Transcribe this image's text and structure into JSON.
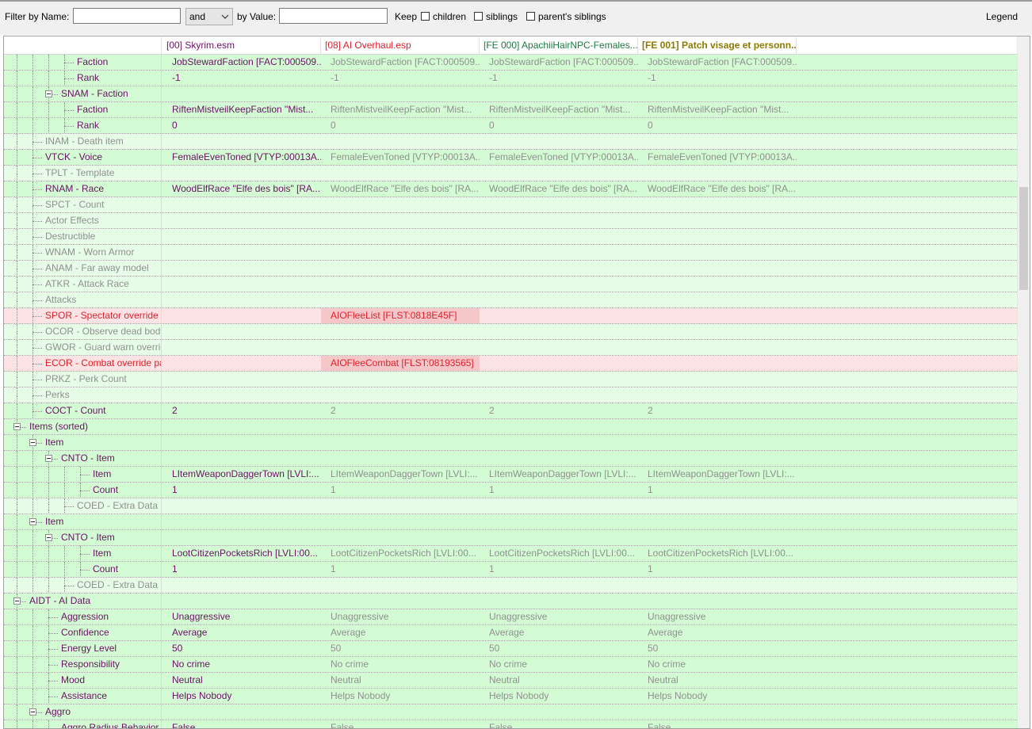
{
  "toolbar": {
    "filter_by_name_label": "Filter by Name:",
    "name_value": "",
    "operator": "and",
    "by_value_label": "by Value:",
    "value_value": "",
    "keep_label": "Keep",
    "children_label": "children",
    "siblings_label": "siblings",
    "parents_siblings_label": "parent's siblings",
    "legend_label": "Legend"
  },
  "columns": [
    {
      "label": "",
      "color": "#000000"
    },
    {
      "label": "[00] Skyrim.esm",
      "color": "#6b0f66"
    },
    {
      "label": "[08] AI Overhaul.esp",
      "color": "#e0202d"
    },
    {
      "label": "[FE 000] ApachiiHairNPC-Females...",
      "color": "#1d7a40"
    },
    {
      "label": "[FE 001] Patch visage et personn...",
      "color": "#8b7a00"
    }
  ],
  "colors": {
    "row_green": "#d4fcd4",
    "row_light_green": "#e8fde8",
    "row_pink": "#fde3e3",
    "cell_red_highlight": "#f6c7c9",
    "label_purple": "#6b0f66",
    "value_gray": "#8f8f8f",
    "conflict_red": "#e0202d"
  },
  "rows": [
    {
      "label": "Faction",
      "depth": 3,
      "expander": false,
      "style": "purple",
      "bg": "green",
      "v": [
        "JobStewardFaction [FACT:000509...",
        "JobStewardFaction [FACT:000509...",
        "JobStewardFaction [FACT:000509...",
        "JobStewardFaction [FACT:000509..."
      ]
    },
    {
      "label": "Rank",
      "depth": 3,
      "expander": false,
      "style": "purple",
      "bg": "green",
      "v": [
        "-1",
        "-1",
        "-1",
        "-1"
      ]
    },
    {
      "label": "SNAM - Faction",
      "depth": 2,
      "expander": true,
      "style": "purple",
      "bg": "green",
      "v": [
        "",
        "",
        "",
        ""
      ]
    },
    {
      "label": "Faction",
      "depth": 3,
      "expander": false,
      "style": "purple",
      "bg": "green",
      "v": [
        "RiftenMistveilKeepFaction \"Mist...",
        "RiftenMistveilKeepFaction \"Mist...",
        "RiftenMistveilKeepFaction \"Mist...",
        "RiftenMistveilKeepFaction \"Mist..."
      ]
    },
    {
      "label": "Rank",
      "depth": 3,
      "expander": false,
      "style": "purple",
      "bg": "green",
      "v": [
        "0",
        "0",
        "0",
        "0"
      ]
    },
    {
      "label": "INAM - Death item",
      "depth": 1,
      "expander": false,
      "style": "gray",
      "bg": "light",
      "v": [
        "",
        "",
        "",
        ""
      ]
    },
    {
      "label": "VTCK - Voice",
      "depth": 1,
      "expander": false,
      "style": "purple",
      "bg": "green",
      "v": [
        "FemaleEvenToned [VTYP:00013A...",
        "FemaleEvenToned [VTYP:00013A...",
        "FemaleEvenToned [VTYP:00013A...",
        "FemaleEvenToned [VTYP:00013A..."
      ]
    },
    {
      "label": "TPLT - Template",
      "depth": 1,
      "expander": false,
      "style": "gray",
      "bg": "light",
      "v": [
        "",
        "",
        "",
        ""
      ]
    },
    {
      "label": "RNAM - Race",
      "depth": 1,
      "expander": false,
      "style": "purple",
      "bg": "green",
      "v": [
        "WoodElfRace \"Elfe des bois\" [RA...",
        "WoodElfRace \"Elfe des bois\" [RA...",
        "WoodElfRace \"Elfe des bois\" [RA...",
        "WoodElfRace \"Elfe des bois\" [RA..."
      ]
    },
    {
      "label": "SPCT - Count",
      "depth": 1,
      "expander": false,
      "style": "gray",
      "bg": "light",
      "v": [
        "",
        "",
        "",
        ""
      ]
    },
    {
      "label": "Actor Effects",
      "depth": 1,
      "expander": false,
      "style": "gray",
      "bg": "light",
      "v": [
        "",
        "",
        "",
        ""
      ]
    },
    {
      "label": "Destructible",
      "depth": 1,
      "expander": false,
      "style": "gray",
      "bg": "light",
      "v": [
        "",
        "",
        "",
        ""
      ]
    },
    {
      "label": "WNAM - Worn Armor",
      "depth": 1,
      "expander": false,
      "style": "gray",
      "bg": "light",
      "v": [
        "",
        "",
        "",
        ""
      ]
    },
    {
      "label": "ANAM - Far away model",
      "depth": 1,
      "expander": false,
      "style": "gray",
      "bg": "light",
      "v": [
        "",
        "",
        "",
        ""
      ]
    },
    {
      "label": "ATKR - Attack Race",
      "depth": 1,
      "expander": false,
      "style": "gray",
      "bg": "light",
      "v": [
        "",
        "",
        "",
        ""
      ]
    },
    {
      "label": "Attacks",
      "depth": 1,
      "expander": false,
      "style": "gray",
      "bg": "light",
      "v": [
        "",
        "",
        "",
        ""
      ]
    },
    {
      "label": "SPOR - Spectator override pa...",
      "depth": 1,
      "expander": false,
      "style": "red",
      "bg": "pink",
      "hl": 1,
      "v": [
        "",
        "AIOFleeList [FLST:0818E45F]",
        "",
        ""
      ]
    },
    {
      "label": "OCOR - Observe dead body ...",
      "depth": 1,
      "expander": false,
      "style": "gray",
      "bg": "light",
      "v": [
        "",
        "",
        "",
        ""
      ]
    },
    {
      "label": "GWOR - Guard warn override...",
      "depth": 1,
      "expander": false,
      "style": "gray",
      "bg": "light",
      "v": [
        "",
        "",
        "",
        ""
      ]
    },
    {
      "label": "ECOR - Combat override pac...",
      "depth": 1,
      "expander": false,
      "style": "red",
      "bg": "pink",
      "hl": 1,
      "v": [
        "",
        "AIOFleeCombat [FLST:08193565]",
        "",
        ""
      ]
    },
    {
      "label": "PRKZ - Perk Count",
      "depth": 1,
      "expander": false,
      "style": "gray",
      "bg": "light",
      "v": [
        "",
        "",
        "",
        ""
      ]
    },
    {
      "label": "Perks",
      "depth": 1,
      "expander": false,
      "style": "gray",
      "bg": "light",
      "v": [
        "",
        "",
        "",
        ""
      ]
    },
    {
      "label": "COCT - Count",
      "depth": 1,
      "expander": false,
      "style": "purple",
      "bg": "green",
      "v": [
        "2",
        "2",
        "2",
        "2"
      ]
    },
    {
      "label": "Items (sorted)",
      "depth": 0,
      "expander": true,
      "style": "purple",
      "bg": "green",
      "v": [
        "",
        "",
        "",
        ""
      ]
    },
    {
      "label": "Item",
      "depth": 1,
      "expander": true,
      "style": "purple",
      "bg": "green",
      "v": [
        "",
        "",
        "",
        ""
      ]
    },
    {
      "label": "CNTO - Item",
      "depth": 2,
      "expander": true,
      "style": "purple",
      "bg": "green",
      "v": [
        "",
        "",
        "",
        ""
      ]
    },
    {
      "label": "Item",
      "depth": 4,
      "expander": false,
      "style": "purple",
      "bg": "green",
      "v": [
        "LItemWeaponDaggerTown [LVLI:...",
        "LItemWeaponDaggerTown [LVLI:...",
        "LItemWeaponDaggerTown [LVLI:...",
        "LItemWeaponDaggerTown [LVLI:..."
      ]
    },
    {
      "label": "Count",
      "depth": 4,
      "expander": false,
      "style": "purple",
      "bg": "green",
      "v": [
        "1",
        "1",
        "1",
        "1"
      ]
    },
    {
      "label": "COED - Extra Data",
      "depth": 3,
      "expander": false,
      "style": "gray",
      "bg": "light",
      "v": [
        "",
        "",
        "",
        ""
      ]
    },
    {
      "label": "Item",
      "depth": 1,
      "expander": true,
      "style": "purple",
      "bg": "green",
      "v": [
        "",
        "",
        "",
        ""
      ]
    },
    {
      "label": "CNTO - Item",
      "depth": 2,
      "expander": true,
      "style": "purple",
      "bg": "green",
      "v": [
        "",
        "",
        "",
        ""
      ]
    },
    {
      "label": "Item",
      "depth": 4,
      "expander": false,
      "style": "purple",
      "bg": "green",
      "v": [
        "LootCitizenPocketsRich [LVLI:00...",
        "LootCitizenPocketsRich [LVLI:00...",
        "LootCitizenPocketsRich [LVLI:00...",
        "LootCitizenPocketsRich [LVLI:00..."
      ]
    },
    {
      "label": "Count",
      "depth": 4,
      "expander": false,
      "style": "purple",
      "bg": "green",
      "v": [
        "1",
        "1",
        "1",
        "1"
      ]
    },
    {
      "label": "COED - Extra Data",
      "depth": 3,
      "expander": false,
      "style": "gray",
      "bg": "light",
      "v": [
        "",
        "",
        "",
        ""
      ]
    },
    {
      "label": "AIDT - AI Data",
      "depth": 0,
      "expander": true,
      "style": "purple",
      "bg": "green",
      "v": [
        "",
        "",
        "",
        ""
      ]
    },
    {
      "label": "Aggression",
      "depth": 2,
      "expander": false,
      "style": "purple",
      "bg": "green",
      "v": [
        "Unaggressive",
        "Unaggressive",
        "Unaggressive",
        "Unaggressive"
      ]
    },
    {
      "label": "Confidence",
      "depth": 2,
      "expander": false,
      "style": "purple",
      "bg": "green",
      "v": [
        "Average",
        "Average",
        "Average",
        "Average"
      ]
    },
    {
      "label": "Energy Level",
      "depth": 2,
      "expander": false,
      "style": "purple",
      "bg": "green",
      "v": [
        "50",
        "50",
        "50",
        "50"
      ]
    },
    {
      "label": "Responsibility",
      "depth": 2,
      "expander": false,
      "style": "purple",
      "bg": "green",
      "v": [
        "No crime",
        "No crime",
        "No crime",
        "No crime"
      ]
    },
    {
      "label": "Mood",
      "depth": 2,
      "expander": false,
      "style": "purple",
      "bg": "green",
      "v": [
        "Neutral",
        "Neutral",
        "Neutral",
        "Neutral"
      ]
    },
    {
      "label": "Assistance",
      "depth": 2,
      "expander": false,
      "style": "purple",
      "bg": "green",
      "v": [
        "Helps Nobody",
        "Helps Nobody",
        "Helps Nobody",
        "Helps Nobody"
      ]
    },
    {
      "label": "Aggro",
      "depth": 1,
      "expander": true,
      "style": "purple",
      "bg": "green",
      "v": [
        "",
        "",
        "",
        ""
      ]
    },
    {
      "label": "Aggro Radius Behavior",
      "depth": 2,
      "expander": false,
      "style": "purple",
      "bg": "green",
      "v": [
        "False",
        "False",
        "False",
        "False"
      ]
    }
  ]
}
